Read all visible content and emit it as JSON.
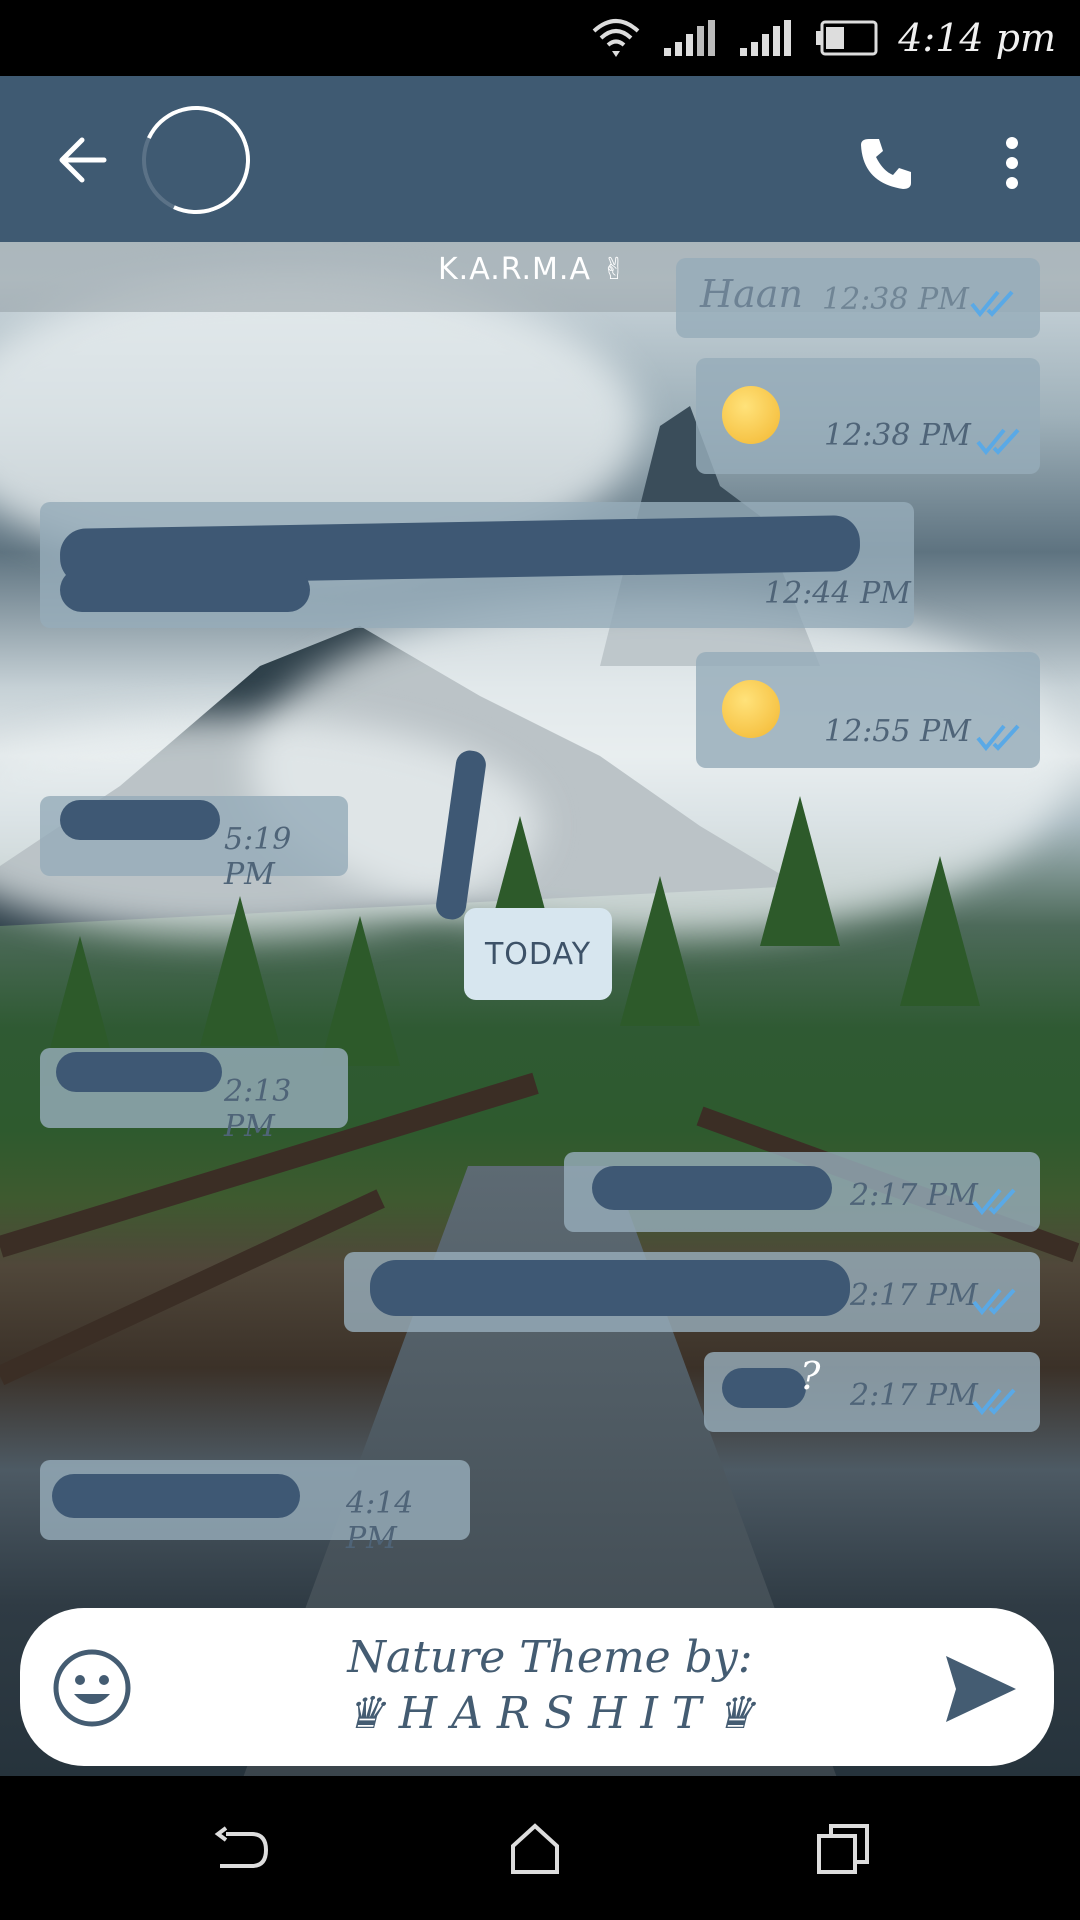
{
  "status_bar": {
    "time": "4:14 pm",
    "icons": [
      "wifi-icon",
      "signal-icon",
      "signal-icon",
      "battery-icon"
    ]
  },
  "header": {
    "back_icon": "arrow-left-icon",
    "call_icon": "phone-icon",
    "more_icon": "more-vertical-icon"
  },
  "status_strip": {
    "text": "K.A.R.M.A ✌"
  },
  "messages": [
    {
      "direction": "out",
      "text": "Haan",
      "time": "12:38 PM"
    },
    {
      "direction": "out",
      "emoji": "😣",
      "time": "12:38 PM"
    },
    {
      "direction": "in",
      "time": "12:44 PM"
    },
    {
      "direction": "out",
      "emoji": "😁",
      "time": "12:55 PM"
    },
    {
      "direction": "in",
      "time": "5:19 PM"
    },
    {
      "direction": "in",
      "time": "2:13 PM"
    },
    {
      "direction": "out",
      "time": "2:17 PM"
    },
    {
      "direction": "out",
      "time": "2:17 PM"
    },
    {
      "direction": "out",
      "text": "?",
      "time": "2:17 PM"
    },
    {
      "direction": "in",
      "time": "4:14 PM"
    }
  ],
  "date_divider": "TODAY",
  "input": {
    "line1": "Nature Theme by:",
    "line2": "♛ H A R S H I T ♛",
    "emoji_icon": "smiley-icon",
    "send_icon": "send-icon"
  },
  "nav_bar": {
    "icons": [
      "back-nav-icon",
      "home-icon",
      "recents-icon"
    ]
  },
  "colors": {
    "header": "#3f5a72",
    "bubble": "#96acba",
    "accent_tick": "#5aa9e6"
  }
}
